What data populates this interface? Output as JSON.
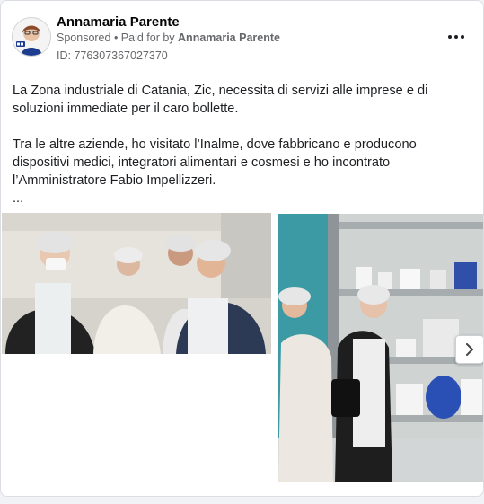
{
  "advertiser": {
    "name": "Annamaria Parente",
    "sponsored_label": "Sponsored",
    "separator": " • ",
    "paid_for_prefix": "Paid for by ",
    "paid_for_name": "Annamaria Parente",
    "ad_id": "ID: 776307367027370"
  },
  "post": {
    "paragraph1": "La Zona industriale di Catania, Zic, necessita di servizi alle imprese e di soluzioni immediate per il caro bollette.",
    "paragraph2": "Tra le altre aziende, ho visitato l’Inalme, dove fabbricano e producono dispositivi medici, integratori alimentari e cosmesi e ho incontrato l’Amministratore Fabio Impellizzeri.",
    "ellipsis": "..."
  },
  "icons": {
    "menu": "more-horizontal-icon",
    "next": "chevron-right-icon"
  },
  "colors": {
    "text_primary": "#050505",
    "text_secondary": "#65676b",
    "card_border": "#dadde1",
    "background": "#f0f2f5"
  }
}
